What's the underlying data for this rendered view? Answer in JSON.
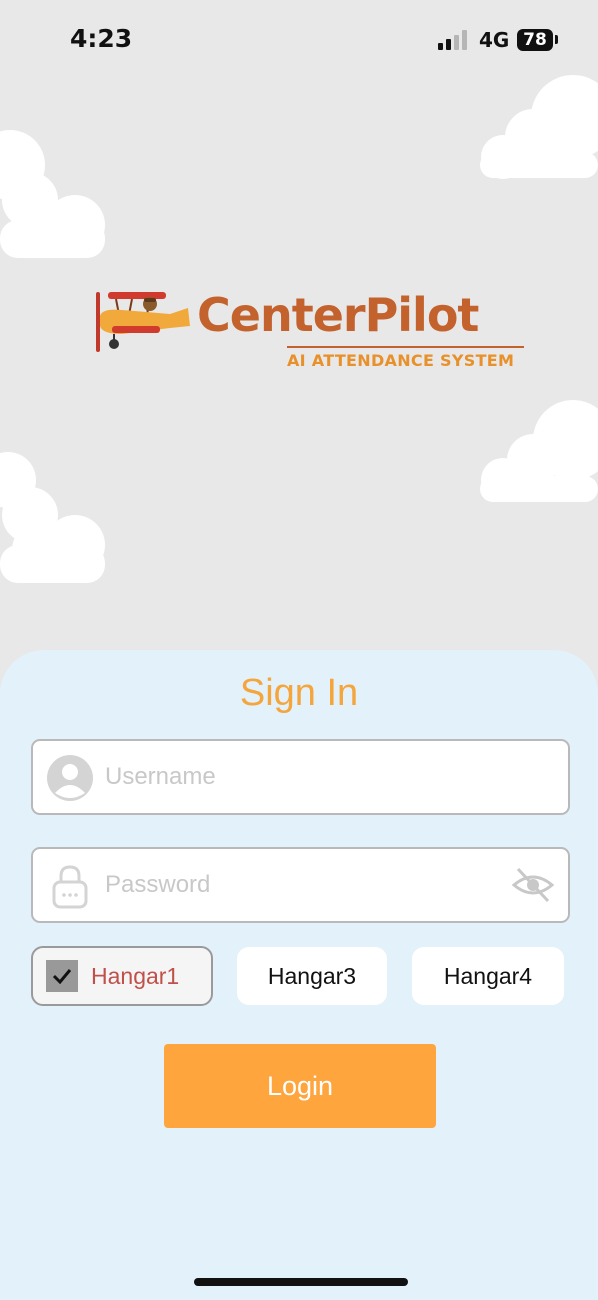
{
  "status_bar": {
    "time": "4:23",
    "network": "4G",
    "battery": "78"
  },
  "logo": {
    "name": "CenterPilot",
    "tagline": "AI ATTENDANCE SYSTEM"
  },
  "sign_in": {
    "title": "Sign In",
    "username_placeholder": "Username",
    "password_placeholder": "Password",
    "hangars": [
      {
        "label": "Hangar1",
        "checked": true
      },
      {
        "label": "Hangar3",
        "checked": false
      },
      {
        "label": "Hangar4",
        "checked": false
      }
    ],
    "login_label": "Login"
  },
  "colors": {
    "accent": "#fea53d",
    "title": "#f4a53c",
    "brand": "#c4622d",
    "panel": "#e3f1fa",
    "background": "#e8e8e8"
  },
  "icons": [
    "user-icon",
    "lock-icon",
    "eye-off-icon",
    "checkmark-icon",
    "signal-icon",
    "airplane-logo"
  ]
}
